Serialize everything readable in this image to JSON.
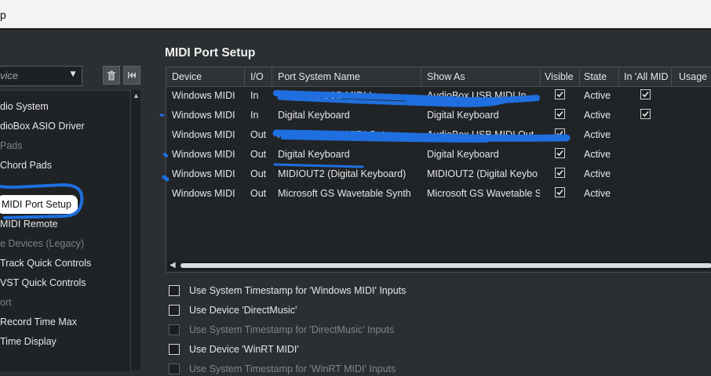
{
  "window": {
    "title_fragment": "p"
  },
  "left_panel": {
    "device_combo": {
      "value": "vice",
      "arrow": "▼"
    },
    "icons": {
      "trash": "trash-icon",
      "collapse": "skip-back-icon"
    },
    "items": [
      {
        "label": "dio System",
        "state": "normal"
      },
      {
        "label": "dioBox ASIO Driver",
        "state": "normal"
      },
      {
        "label": "Pads",
        "state": "dim"
      },
      {
        "label": "Chord Pads",
        "state": "normal"
      },
      {
        "label": "MIDI Port Setup",
        "state": "selected"
      },
      {
        "label": "MIDI Remote",
        "state": "normal"
      },
      {
        "label": "e Devices (Legacy)",
        "state": "dim"
      },
      {
        "label": "Track Quick Controls",
        "state": "normal"
      },
      {
        "label": "VST Quick Controls",
        "state": "normal"
      },
      {
        "label": "ort",
        "state": "dim"
      },
      {
        "label": "Record Time Max",
        "state": "normal"
      },
      {
        "label": "Time Display",
        "state": "normal"
      }
    ]
  },
  "main": {
    "heading": "MIDI Port Setup",
    "table": {
      "columns": [
        "Device",
        "I/O",
        "Port System Name",
        "Show As",
        "Visible",
        "State",
        "In 'All MID",
        "Usage"
      ],
      "rows": [
        {
          "device": "Windows MIDI",
          "io": "In",
          "port": "AudioBox USB MIDI In",
          "show": "AudioBox USB MIDI In",
          "visible": true,
          "state": "Active",
          "all_midi": true
        },
        {
          "device": "Windows MIDI",
          "io": "In",
          "port": "Digital Keyboard",
          "show": "Digital Keyboard",
          "visible": true,
          "state": "Active",
          "all_midi": true
        },
        {
          "device": "Windows MIDI",
          "io": "Out",
          "port": "AudioBox USB MIDI Out",
          "show": "AudioBox USB MIDI Out",
          "visible": true,
          "state": "Active",
          "all_midi": null
        },
        {
          "device": "Windows MIDI",
          "io": "Out",
          "port": "Digital Keyboard",
          "show": "Digital Keyboard",
          "visible": true,
          "state": "Active",
          "all_midi": null
        },
        {
          "device": "Windows MIDI",
          "io": "Out",
          "port": "MIDIOUT2 (Digital Keyboard)",
          "show": "MIDIOUT2 (Digital Keybo",
          "visible": true,
          "state": "Active",
          "all_midi": null
        },
        {
          "device": "Windows MIDI",
          "io": "Out",
          "port": "Microsoft GS Wavetable Synth",
          "show": "Microsoft GS Wavetable S",
          "visible": true,
          "state": "Active",
          "all_midi": null
        }
      ]
    },
    "options": [
      {
        "label": "Use System Timestamp for 'Windows MIDI' Inputs",
        "checked": false,
        "enabled": true
      },
      {
        "label": "Use Device 'DirectMusic'",
        "checked": false,
        "enabled": true
      },
      {
        "label": "Use System Timestamp for 'DirectMusic' Inputs",
        "checked": false,
        "enabled": false
      },
      {
        "label": "Use Device 'WinRT MIDI'",
        "checked": false,
        "enabled": true
      },
      {
        "label": "Use System Timestamp for 'WinRT MIDI' Inputs",
        "checked": false,
        "enabled": false
      }
    ]
  },
  "colors": {
    "annotation": "#1f6fe0",
    "panel": "#2b2f32",
    "table_bg": "#212427"
  }
}
